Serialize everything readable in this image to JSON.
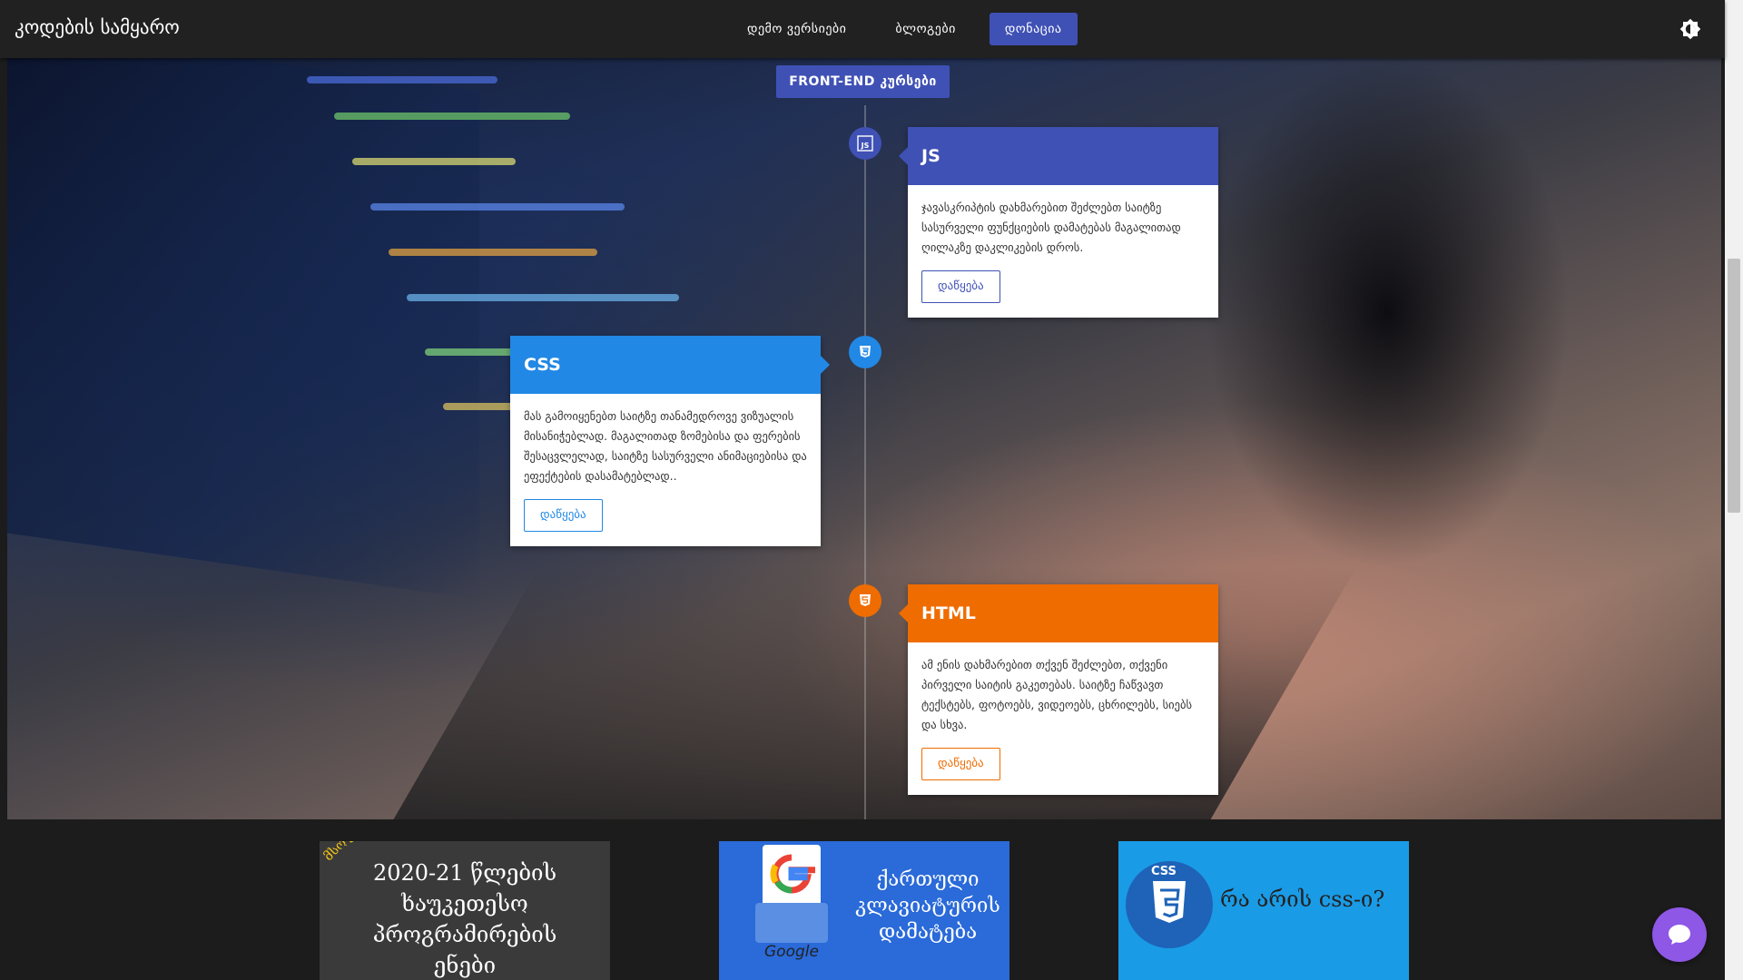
{
  "header": {
    "brand": "კოდების სამყარო",
    "nav": [
      {
        "label": "დემო ვერსიები",
        "active": false
      },
      {
        "label": "ბლოგები",
        "active": false
      },
      {
        "label": "დონაცია",
        "active": true
      }
    ],
    "theme_icon": "brightness-icon"
  },
  "hero": {
    "badge": "FRONT-END კურსები",
    "cards": [
      {
        "title": "JS",
        "icon": "js-icon",
        "color": "#3f51b5",
        "text": "ჯავასკრიპტის დახმარებით შეძლებთ საიტზე სასურველი ფუნქციების დამატებას მაგალითად ღილაკზე დაკლიკების დროს.",
        "button": "დაწყება"
      },
      {
        "title": "CSS",
        "icon": "css3-icon",
        "color": "#2188e5",
        "text": "მას გამოიყენებთ საიტზე თანამედროვე ვიზუალის მისანიჭებლად. მაგალითად ზომებისა და ფერების შესაცვლელად, საიტზე სასურველი ანიმაციებისა და ეფექტების დასამატებლად..",
        "button": "დაწყება"
      },
      {
        "title": "HTML",
        "icon": "html5-icon",
        "color": "#ef6c00",
        "text": "ამ ენის დახმარებით თქვენ შეძლებთ, თქვენი პირველი საიტის გაკეთებას. საიტზე ჩაწვავთ ტექსტებს, ფოტოებს, ვიდეოებს, ცხრილებს, სიებს და სხვა.",
        "button": "დაწყება"
      }
    ]
  },
  "blogs": [
    {
      "ribbon": "მსოფლიო",
      "title": "2020-21 წლების ხაუკეთესო პროგრამირების ენები"
    },
    {
      "title": "ქართული კლავიატურის დამატება",
      "brand": "Google"
    },
    {
      "logo_text": "CSS",
      "title": "რა არის css-ი?"
    }
  ],
  "colors": {
    "accent": "#3f51b5",
    "chat": "#8e57e6"
  }
}
